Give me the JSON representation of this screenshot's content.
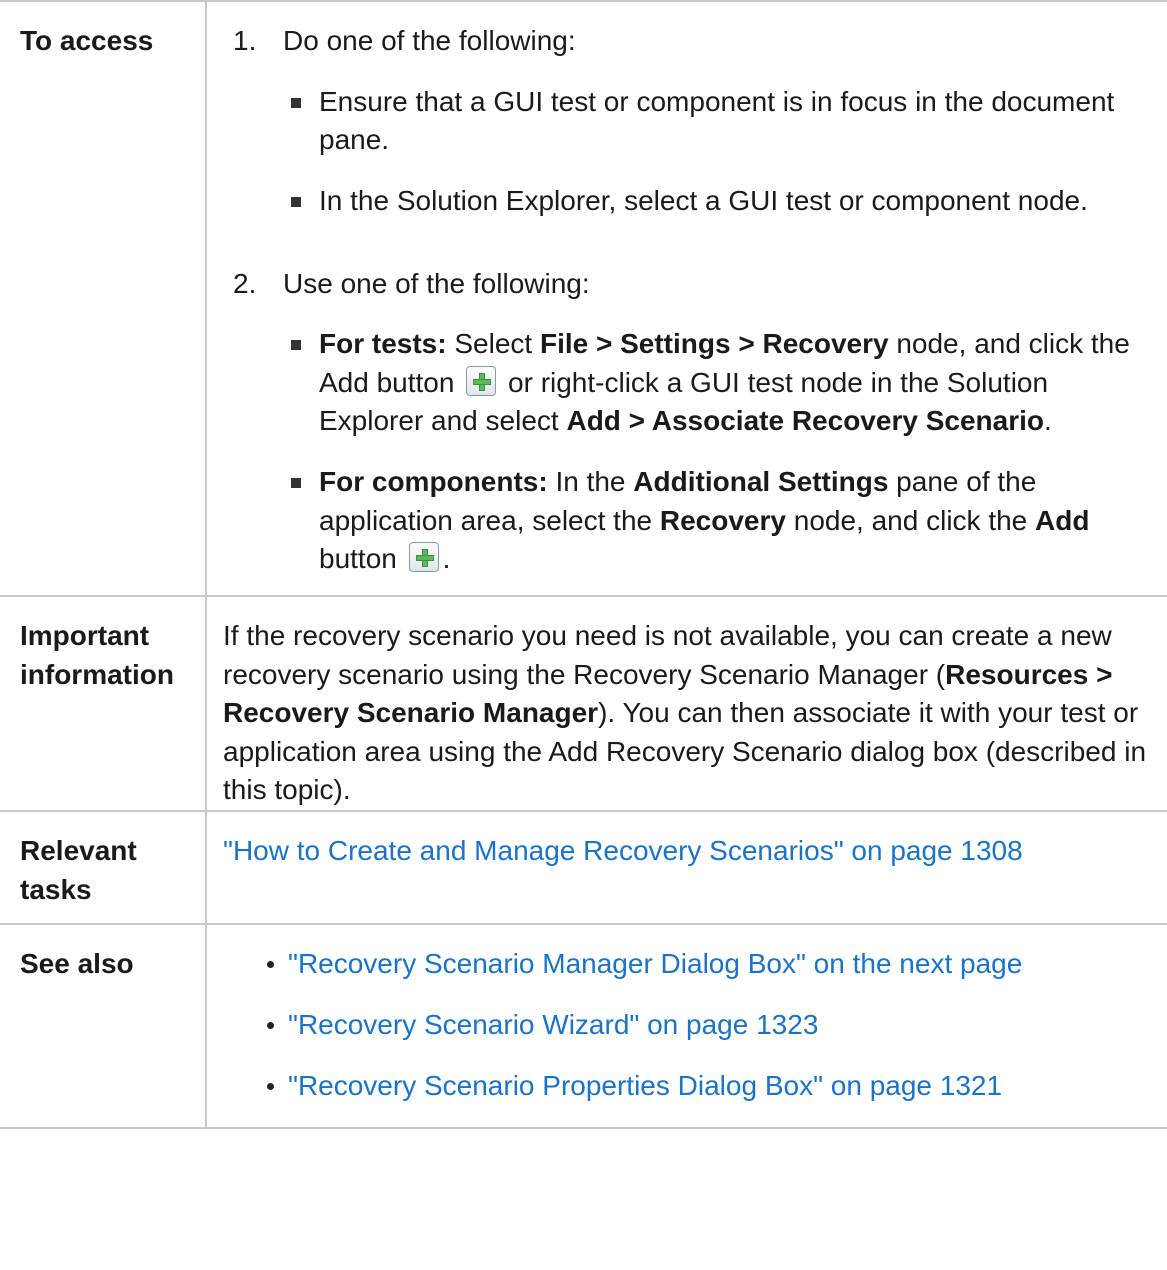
{
  "rows": {
    "access": {
      "label": "To access",
      "step1": {
        "num": "1.",
        "text": "Do one of the following:",
        "sub1": "Ensure that a GUI test or component is in focus in the document pane.",
        "sub2": "In the Solution Explorer, select a GUI test or component node."
      },
      "step2": {
        "num": "2.",
        "text": "Use one of the following:",
        "tests": {
          "lead": "For tests:",
          "t1": " Select ",
          "b1": "File > Settings > Recovery",
          "t2": " node, and click the Add button ",
          "t3": " or right-click a GUI test node in the Solution Explorer and select ",
          "b2": "Add > Associate Recovery Scenario",
          "t4": "."
        },
        "components": {
          "lead": "For components:",
          "t1": " In the ",
          "b1": "Additional Settings",
          "t2": " pane of the application area, select the ",
          "b2": "Recovery",
          "t3": " node, and click the ",
          "b3": "Add",
          "t4": " button ",
          "t5": "."
        }
      },
      "add_icon": "add-plus-icon"
    },
    "important": {
      "label": "Important information",
      "t1": "If the recovery scenario you need is not available, you can create a new recovery scenario using the Recovery Scenario Manager (",
      "b1": "Resources > Recovery Scenario Manager",
      "t2": "). You can then associate it with your test or application area using the Add Recovery Scenario dialog box (described in this topic)."
    },
    "tasks": {
      "label": "Relevant tasks",
      "link": "\"How to Create and Manage Recovery Scenarios\" on page 1308"
    },
    "see_also": {
      "label": "See also",
      "links": [
        "\"Recovery Scenario Manager Dialog Box\" on the next page",
        "\"Recovery Scenario Wizard\" on page 1323",
        "\"Recovery Scenario Properties Dialog Box\" on page 1321"
      ]
    }
  },
  "colors": {
    "link": "#1a73c8",
    "border": "#c8c8c8",
    "text": "#1a1a1a"
  }
}
